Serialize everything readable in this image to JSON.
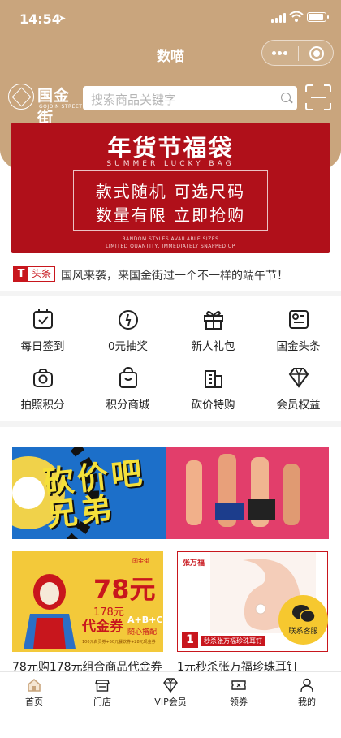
{
  "status_bar": {
    "time": "14:54"
  },
  "nav": {
    "title": "数喵"
  },
  "brand": {
    "name": "国金街",
    "subname": "GOJOIN STREET"
  },
  "search": {
    "placeholder": "搜索商品关键字"
  },
  "banner": {
    "title": "年货节福袋",
    "subtitle": "SUMMER LUCKY BAG",
    "line1": "款式随机 可选尺码",
    "line2": "数量有限 立即抢购",
    "footnote1": "RANDOM STYLES AVAILABLE SIZES",
    "footnote2": "LIMITED QUANTITY, IMMEDIATELY SNAPPED UP",
    "bg_color": "#b0101a"
  },
  "news": {
    "badge_letter": "T",
    "badge_label": "头条",
    "text": "国风来袭，来国金街过一个不一样的端午节！"
  },
  "grid": [
    {
      "label": "每日签到",
      "icon": "calendar-check-icon"
    },
    {
      "label": "0元抽奖",
      "icon": "lottery-icon"
    },
    {
      "label": "新人礼包",
      "icon": "gift-icon"
    },
    {
      "label": "国金头条",
      "icon": "news-icon"
    },
    {
      "label": "拍照积分",
      "icon": "camera-icon"
    },
    {
      "label": "积分商城",
      "icon": "shopping-bag-icon"
    },
    {
      "label": "砍价特购",
      "icon": "building-icon"
    },
    {
      "label": "会员权益",
      "icon": "diamond-icon"
    }
  ],
  "promo": {
    "title": "砍价吧兄弟"
  },
  "cards": [
    {
      "price": "78元",
      "small": "178元",
      "word": "代金券",
      "combo": "A+B+C",
      "combo_note": "随心搭配",
      "brand": "国金街",
      "fine": "100元白灵券+50元餐饮券+28元现金券",
      "caption": "78元购178元组合商品代金券"
    },
    {
      "brand_top": "张万福",
      "tag": "秒杀张万福珍珠耳钉",
      "num": "1",
      "caption": "1元秒杀张万福珍珠耳钉"
    }
  ],
  "service": {
    "label": "联系客服"
  },
  "tabs": [
    {
      "label": "首页",
      "icon": "home-icon"
    },
    {
      "label": "门店",
      "icon": "store-icon"
    },
    {
      "label": "VIP会员",
      "icon": "vip-diamond-icon"
    },
    {
      "label": "领券",
      "icon": "coupon-icon"
    },
    {
      "label": "我的",
      "icon": "user-icon"
    }
  ],
  "colors": {
    "brand_gold": "#c9a57d",
    "accent_red": "#c8161d",
    "service_yellow": "#f6c82f"
  }
}
